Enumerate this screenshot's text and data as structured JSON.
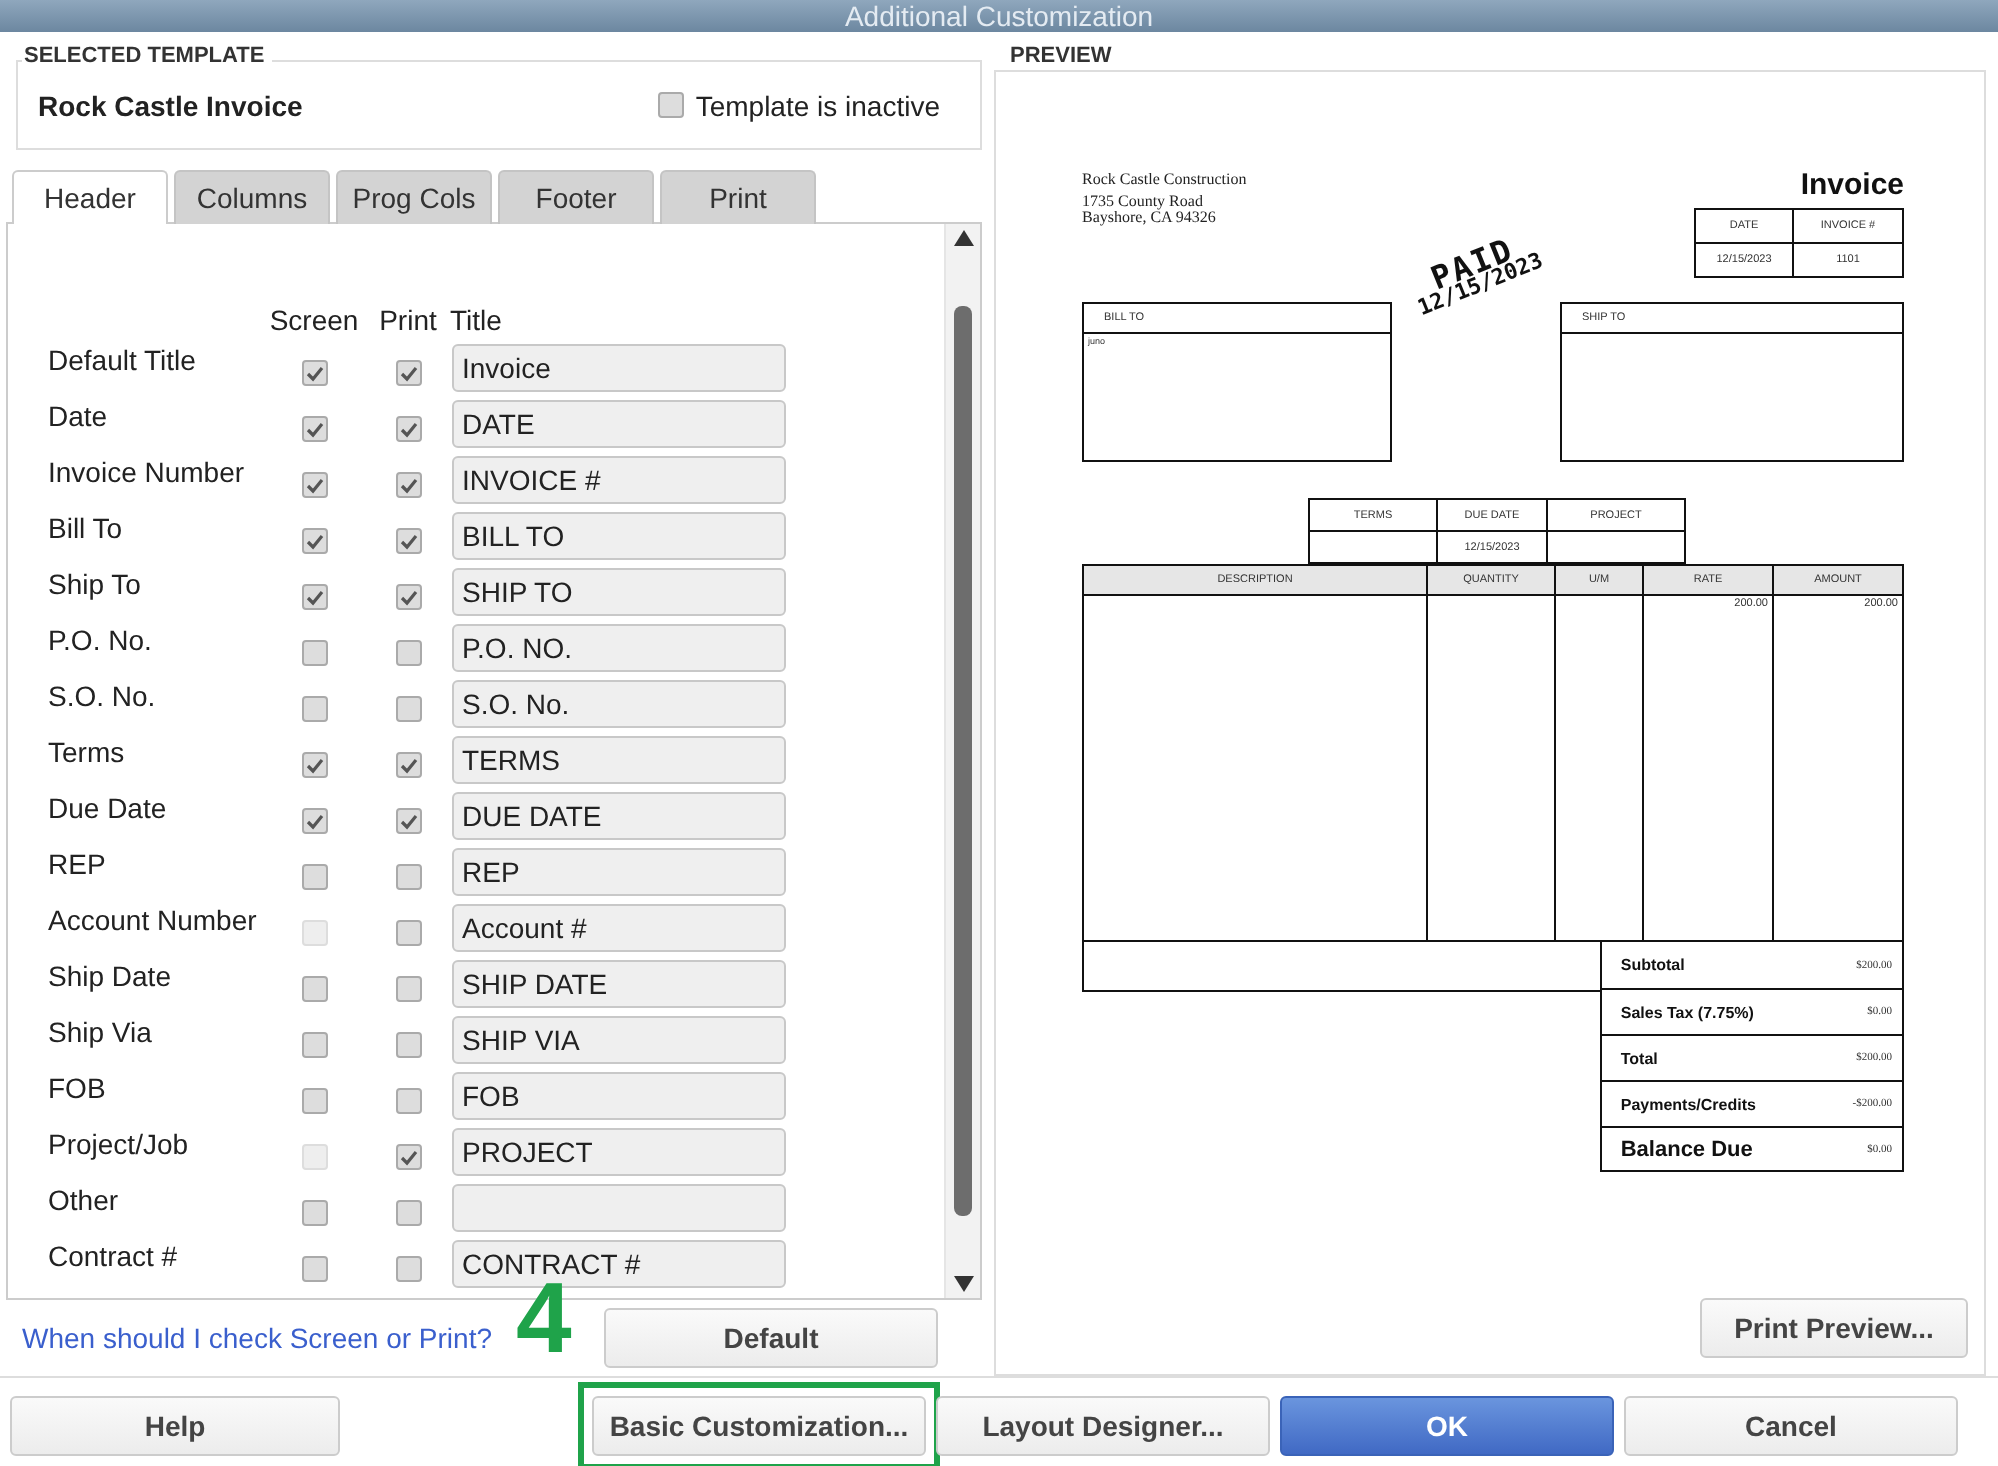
{
  "window": {
    "title": "Additional Customization"
  },
  "selected_template": {
    "legend": "SELECTED TEMPLATE",
    "name": "Rock Castle Invoice",
    "inactive": {
      "label": "Template is inactive",
      "checked": false
    }
  },
  "tabs": [
    {
      "label": "Header",
      "selected": true
    },
    {
      "label": "Columns",
      "selected": false
    },
    {
      "label": "Prog Cols",
      "selected": false
    },
    {
      "label": "Footer",
      "selected": false
    },
    {
      "label": "Print",
      "selected": false
    }
  ],
  "header_columns": [
    "Screen",
    "Print",
    "Title"
  ],
  "fields": [
    {
      "label": "Default Title",
      "screen": {
        "checked": true,
        "disabled": false
      },
      "print": {
        "checked": true,
        "disabled": false
      },
      "title": "Invoice"
    },
    {
      "label": "Date",
      "screen": {
        "checked": true,
        "disabled": false
      },
      "print": {
        "checked": true,
        "disabled": false
      },
      "title": "DATE"
    },
    {
      "label": "Invoice Number",
      "screen": {
        "checked": true,
        "disabled": false
      },
      "print": {
        "checked": true,
        "disabled": false
      },
      "title": "INVOICE #"
    },
    {
      "label": "Bill To",
      "screen": {
        "checked": true,
        "disabled": false
      },
      "print": {
        "checked": true,
        "disabled": false
      },
      "title": "BILL TO"
    },
    {
      "label": "Ship To",
      "screen": {
        "checked": true,
        "disabled": false
      },
      "print": {
        "checked": true,
        "disabled": false
      },
      "title": "SHIP TO"
    },
    {
      "label": "P.O. No.",
      "screen": {
        "checked": false,
        "disabled": false
      },
      "print": {
        "checked": false,
        "disabled": false
      },
      "title": "P.O. NO."
    },
    {
      "label": "S.O. No.",
      "screen": {
        "checked": false,
        "disabled": false
      },
      "print": {
        "checked": false,
        "disabled": false
      },
      "title": "S.O. No."
    },
    {
      "label": "Terms",
      "screen": {
        "checked": true,
        "disabled": false
      },
      "print": {
        "checked": true,
        "disabled": false
      },
      "title": "TERMS"
    },
    {
      "label": "Due Date",
      "screen": {
        "checked": true,
        "disabled": false
      },
      "print": {
        "checked": true,
        "disabled": false
      },
      "title": "DUE DATE"
    },
    {
      "label": "REP",
      "screen": {
        "checked": false,
        "disabled": false
      },
      "print": {
        "checked": false,
        "disabled": false
      },
      "title": "REP"
    },
    {
      "label": "Account Number",
      "screen": {
        "checked": false,
        "disabled": true
      },
      "print": {
        "checked": false,
        "disabled": false
      },
      "title": "Account #"
    },
    {
      "label": "Ship Date",
      "screen": {
        "checked": false,
        "disabled": false
      },
      "print": {
        "checked": false,
        "disabled": false
      },
      "title": "SHIP DATE"
    },
    {
      "label": "Ship Via",
      "screen": {
        "checked": false,
        "disabled": false
      },
      "print": {
        "checked": false,
        "disabled": false
      },
      "title": "SHIP VIA"
    },
    {
      "label": "FOB",
      "screen": {
        "checked": false,
        "disabled": false
      },
      "print": {
        "checked": false,
        "disabled": false
      },
      "title": "FOB"
    },
    {
      "label": "Project/Job",
      "screen": {
        "checked": false,
        "disabled": true
      },
      "print": {
        "checked": true,
        "disabled": false
      },
      "title": "PROJECT"
    },
    {
      "label": "Other",
      "screen": {
        "checked": false,
        "disabled": false
      },
      "print": {
        "checked": false,
        "disabled": false
      }
    },
    {
      "label": "Contract #",
      "screen": {
        "checked": false,
        "disabled": false
      },
      "print": {
        "checked": false,
        "disabled": false
      },
      "title": "CONTRACT #"
    }
  ],
  "help_link": "When should I check Screen or Print?",
  "default_button": "Default",
  "annotation": {
    "step": "4"
  },
  "preview": {
    "legend": "PREVIEW",
    "print_preview_button": "Print Preview...",
    "invoice": {
      "company": [
        "Rock Castle Construction",
        "1735 County Road",
        "Bayshore, CA 94326"
      ],
      "title": "Invoice",
      "info": {
        "headers": [
          "DATE",
          "INVOICE #"
        ],
        "values": [
          "12/15/2023",
          "1101"
        ]
      },
      "stamp": {
        "text": "PAID",
        "date": "12/15/2023"
      },
      "bill_to": {
        "label": "BILL TO",
        "text": "juno"
      },
      "ship_to": {
        "label": "SHIP TO"
      },
      "terms": {
        "headers": [
          "TERMS",
          "DUE DATE",
          "PROJECT"
        ],
        "due_date": "12/15/2023"
      },
      "items": {
        "columns": [
          "DESCRIPTION",
          "QUANTITY",
          "U/M",
          "RATE",
          "AMOUNT"
        ],
        "rate": "200.00",
        "amount": "200.00"
      },
      "totals": [
        {
          "label": "Subtotal",
          "value": "$200.00",
          "big": false
        },
        {
          "label": "Sales Tax  (7.75%)",
          "value": "$0.00",
          "big": false
        },
        {
          "label": "Total",
          "value": "$200.00",
          "big": false
        },
        {
          "label": "Payments/Credits",
          "value": "-$200.00",
          "big": false
        },
        {
          "label": "Balance Due",
          "value": "$0.00",
          "big": true
        }
      ]
    }
  },
  "buttons": [
    {
      "label": "Help",
      "primary": false,
      "highlighted": false
    },
    {
      "label": "Basic Customization...",
      "primary": false,
      "highlighted": true
    },
    {
      "label": "Layout Designer...",
      "primary": false,
      "highlighted": false
    },
    {
      "label": "OK",
      "primary": true,
      "highlighted": false
    },
    {
      "label": "Cancel",
      "primary": false,
      "highlighted": false
    }
  ]
}
